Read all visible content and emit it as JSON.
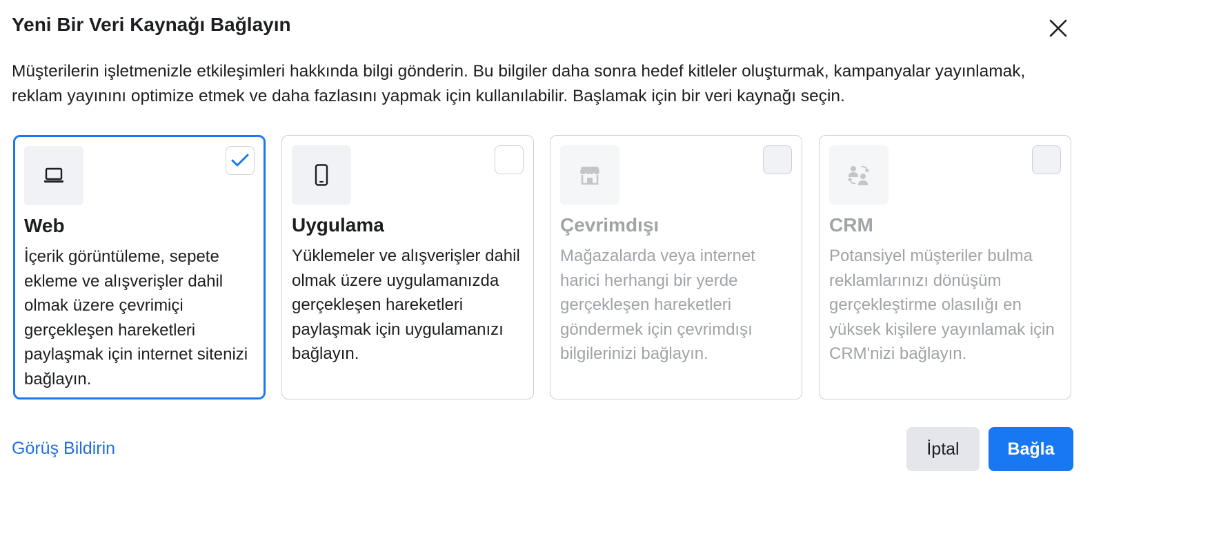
{
  "dialog": {
    "title": "Yeni Bir Veri Kaynağı Bağlayın",
    "close_icon": "close-icon",
    "description": "Müşterilerin işletmenizle etkileşimleri hakkında bilgi gönderin. Bu bilgiler daha sonra hedef kitleler oluşturmak, kampanyalar yayınlamak, reklam yayınını optimize etmek ve daha fazlasını yapmak için kullanılabilir. Başlamak için bir veri kaynağı seçin."
  },
  "sources": [
    {
      "title": "Web",
      "description": "İçerik görüntüleme, sepete ekleme ve alışverişler dahil olmak üzere çevrimiçi gerçekleşen hareketleri paylaşmak için internet sitenizi bağlayın.",
      "icon": "laptop-icon",
      "selected": true,
      "disabled": false
    },
    {
      "title": "Uygulama",
      "description": "Yüklemeler ve alışverişler dahil olmak üzere uygulamanızda gerçekleşen hareketleri paylaşmak için uygulamanızı bağlayın.",
      "icon": "mobile-phone-icon",
      "selected": false,
      "disabled": false
    },
    {
      "title": "Çevrimdışı",
      "description": "Mağazalarda veya internet harici herhangi bir yerde gerçekleşen hareketleri göndermek için çevrimdışı bilgilerinizi bağlayın.",
      "icon": "store-icon",
      "selected": false,
      "disabled": true
    },
    {
      "title": "CRM",
      "description": "Potansiyel müşteriler bulma reklamlarınızı dönüşüm gerçekleştirme olasılığı en yüksek kişilere yayınlamak için CRM'nizi bağlayın.",
      "icon": "people-sync-icon",
      "selected": false,
      "disabled": true
    }
  ],
  "footer": {
    "feedback_link": "Görüş Bildirin",
    "cancel_label": "İptal",
    "connect_label": "Bağla"
  },
  "colors": {
    "accent": "#1877f2",
    "link": "#216fdb",
    "disabled_text": "#a0a3a8"
  }
}
